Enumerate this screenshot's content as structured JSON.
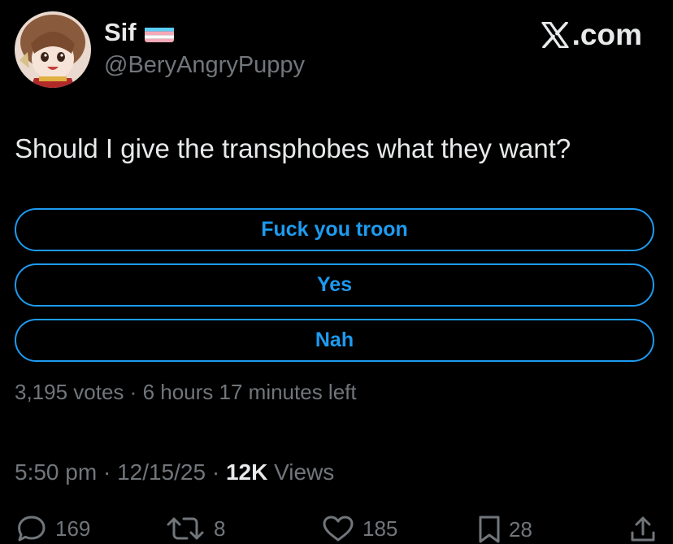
{
  "author": {
    "display_name": "Sif",
    "handle": "@BeryAngryPuppy",
    "flag_icon": "transgender-flag-icon"
  },
  "brand": {
    "label": ".com",
    "icon": "x-logo-icon"
  },
  "tweet": {
    "text": "Should I give the transphobes what they want?"
  },
  "poll": {
    "options": [
      {
        "label": "Fuck you troon"
      },
      {
        "label": "Yes"
      },
      {
        "label": "Nah"
      }
    ],
    "votes": "3,195 votes",
    "separator": "·",
    "time_left": "6 hours 17 minutes left"
  },
  "meta": {
    "time": "5:50 pm",
    "date": "12/15/25",
    "separator": "·",
    "views_count": "12K",
    "views_label": "Views"
  },
  "actions": {
    "replies": "169",
    "reposts": "8",
    "likes": "185",
    "bookmarks": "28"
  },
  "colors": {
    "background": "#000000",
    "accent": "#1d9bf0",
    "text_primary": "#e7e9ea",
    "text_secondary": "#71767b"
  }
}
